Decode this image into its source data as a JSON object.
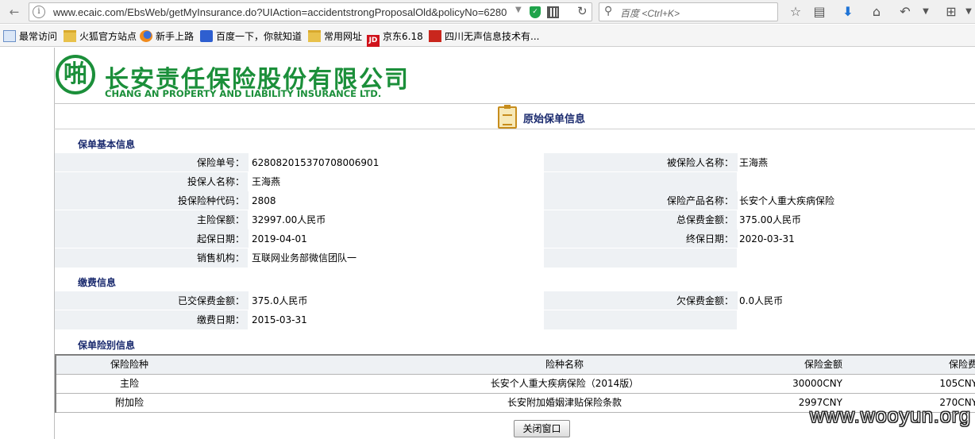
{
  "browser": {
    "url": "www.ecaic.com/EbsWeb/getMyInsurance.do?UIAction=accidentstrongProposalOld&policyNo=6280",
    "search_placeholder": "百度 <Ctrl+K>",
    "bookmarks": [
      {
        "label": "最常访问",
        "icon": "page-icon"
      },
      {
        "label": "火狐官方站点",
        "icon": "folder-icon"
      },
      {
        "label": "新手上路",
        "icon": "firefox-icon"
      },
      {
        "label": "百度一下，你就知道",
        "icon": "baidu-paw-icon"
      },
      {
        "label": "常用网址",
        "icon": "folder-icon"
      },
      {
        "label": "京东6.18",
        "icon": "jd-icon"
      },
      {
        "label": "四川无声信息技术有...",
        "icon": "site-icon"
      }
    ]
  },
  "company": {
    "name_cn": "长安责任保险股份有限公司",
    "name_en": "CHANG AN PROPERTY AND LIABILITY INSURANCE LTD.",
    "brand_color": "#1b8f3a"
  },
  "page_title": "原始保单信息",
  "basic": {
    "heading": "保单基本信息",
    "rows": [
      {
        "l1": "保险单号：",
        "v1": "628082015370708006901",
        "l2": "被保险人名称：",
        "v2": "王海燕"
      },
      {
        "l1": "投保人名称：",
        "v1": "王海燕",
        "l2": "",
        "v2": ""
      },
      {
        "l1": "投保险种代码：",
        "v1": "2808",
        "l2": "保险产品名称：",
        "v2": "长安个人重大疾病保险"
      },
      {
        "l1": "主险保额：",
        "v1": "32997.00人民币",
        "l2": "总保费金额：",
        "v2": "375.00人民币"
      },
      {
        "l1": "起保日期：",
        "v1": "2019-04-01",
        "l2": "终保日期：",
        "v2": "2020-03-31"
      },
      {
        "l1": "销售机构：",
        "v1": "互联网业务部微信团队一",
        "l2": "",
        "v2": ""
      }
    ]
  },
  "payment": {
    "heading": "缴费信息",
    "rows": [
      {
        "l1": "已交保费金额：",
        "v1": "375.0人民币",
        "l2": "欠保费金额：",
        "v2": "0.0人民币"
      },
      {
        "l1": "缴费日期：",
        "v1": "2015-03-31",
        "l2": "",
        "v2": ""
      }
    ]
  },
  "coverage": {
    "heading": "保单险别信息",
    "headers": [
      "保险险种",
      "险种名称",
      "保险金额",
      "保险费"
    ],
    "rows": [
      [
        "主险",
        "长安个人重大疾病保险（2014版）",
        "30000CNY",
        "105CNY"
      ],
      [
        "附加险",
        "长安附加婚姻津贴保险条款",
        "2997CNY",
        "270CNY"
      ]
    ]
  },
  "close_button": "关闭窗口",
  "watermark": "www.wooyun.org"
}
